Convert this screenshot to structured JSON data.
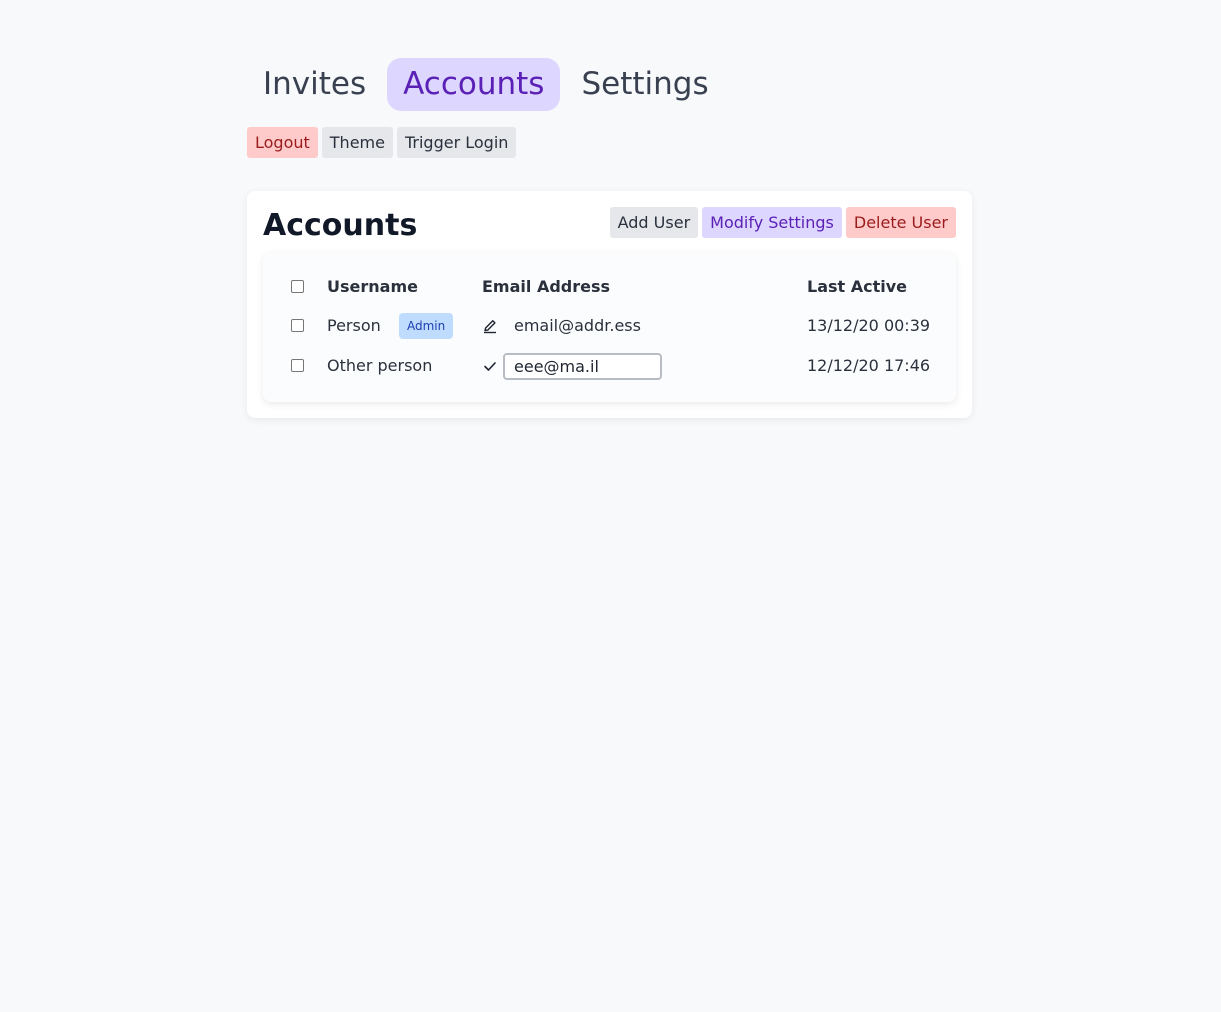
{
  "nav": {
    "tabs": [
      {
        "label": "Invites",
        "active": false
      },
      {
        "label": "Accounts",
        "active": true
      },
      {
        "label": "Settings",
        "active": false
      }
    ]
  },
  "actions": {
    "logout": "Logout",
    "theme": "Theme",
    "trigger_login": "Trigger Login"
  },
  "accounts": {
    "title": "Accounts",
    "buttons": {
      "add_user": "Add User",
      "modify_settings": "Modify Settings",
      "delete_user": "Delete User"
    },
    "columns": {
      "username": "Username",
      "email": "Email Address",
      "last_active": "Last Active"
    },
    "rows": [
      {
        "username": "Person",
        "badge": "Admin",
        "email_icon": "edit-icon",
        "email": "email@addr.ess",
        "last_active": "13/12/20 00:39",
        "editing": false
      },
      {
        "username": "Other person",
        "badge": "",
        "email_icon": "check-icon",
        "email": "eee@ma.il",
        "last_active": "12/12/20 17:46",
        "editing": true
      }
    ]
  },
  "colors": {
    "accent_bg": "#ddd6fe",
    "accent_text": "#5b21b6",
    "danger_bg": "#fecaca",
    "danger_text": "#9b1c1c",
    "badge_bg": "#bfdbfe",
    "badge_text": "#1e40af"
  }
}
